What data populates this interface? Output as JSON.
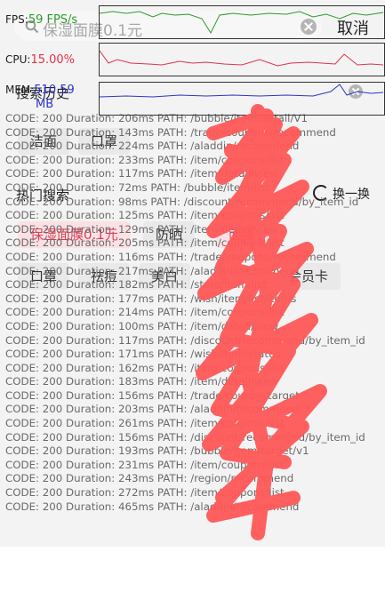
{
  "search": {
    "placeholder_text": "保湿面膜0.1元",
    "cancel_label": "取消"
  },
  "history": {
    "title": "搜索历史",
    "items": [
      "洁面",
      "口罩"
    ]
  },
  "hot": {
    "title": "热门搜索",
    "refresh_label": "换一换",
    "items": [
      "保湿面膜0.1元",
      "防晒",
      "面膜",
      "口罩",
      "祛痘",
      "美白",
      "会员卡"
    ]
  },
  "perf": {
    "fps_label": "FPS:",
    "fps_value": "59 FPS/s",
    "cpu_label": "CPU:",
    "cpu_value": "15.00%",
    "mem_label": "MEM:",
    "mem_value": "510.59",
    "mem_unit": "MB",
    "colors": {
      "fps": "#2c9b2c",
      "cpu": "#e0324a",
      "mem": "#2d33c8"
    }
  },
  "log_lines": [
    "CODE: 200 Duration: 206ms  PATH: /bubble/item/detail/V1",
    "CODE: 200 Duration: 143ms  PATH: /trade/coupons/recommend",
    "CODE: 200 Duration: 224ms  PATH: /aladdin/recommend",
    "CODE: 200 Duration: 233ms  PATH: /item/coupons/list",
    "CODE: 200 Duration: 117ms  PATH: /item/detail/view",
    "CODE: 200 Duration: 72ms  PATH: /bubble/item/list",
    "CODE: 200 Duration: 98ms  PATH: /discount/recommend/by_item_id",
    "CODE: 200 Duration: 125ms  PATH: /item/coupons/list",
    "CODE: 200 Duration: 129ms  PATH: /item/detail/view",
    "CODE: 200 Duration: 205ms  PATH: /item/coupons/list",
    "CODE: 200 Duration: 116ms  PATH: /trade/coupons/recommend",
    "CODE: 200 Duration: 217ms  PATH: /aladdin/recommend",
    "CODE: 200 Duration: 182ms  PATH: /store/item/list",
    "CODE: 200 Duration: 177ms  PATH: /wish/item/list/items",
    "CODE: 200 Duration: 214ms  PATH: /item/coupons/list",
    "CODE: 200 Duration: 100ms  PATH: /item/detail/view",
    "CODE: 200 Duration: 117ms  PATH: /discount/recommend/by_item_id",
    "CODE: 200 Duration: 171ms  PATH: /wish/item/status",
    "CODE: 200 Duration: 162ms  PATH: /item/coupons/list",
    "CODE: 200 Duration: 183ms  PATH: /item/detail/view",
    "CODE: 200 Duration: 156ms  PATH: /trade/coupon/target",
    "CODE: 200 Duration: 203ms  PATH: /aladdin/recommend",
    "CODE: 200 Duration: 261ms  PATH: /item/coupons/list",
    "CODE: 200 Duration: 156ms  PATH: /discount/recommend/by_item_id",
    "CODE: 200 Duration: 193ms  PATH: /bubble/item/target/v1",
    "CODE: 200 Duration: 231ms  PATH: /item/coupons/list",
    "CODE: 200 Duration: 243ms  PATH: /region/recommend",
    "CODE: 200 Duration: 272ms  PATH: /item/coupons/list",
    "CODE: 200 Duration: 465ms  PATH: /aladdin/recommend"
  ]
}
